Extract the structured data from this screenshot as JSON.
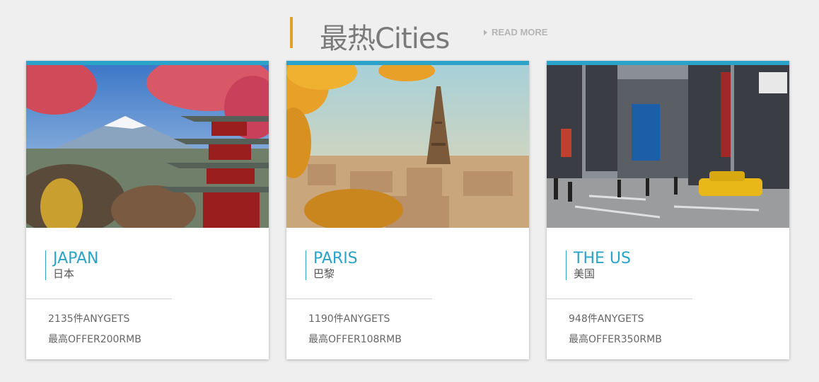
{
  "header": {
    "title": "最热Cities",
    "read_more": "READ MORE"
  },
  "colors": {
    "accent": "#2ba3c8",
    "header_bar": "#e0a02a",
    "background": "#efefef"
  },
  "cards": [
    {
      "name_en": "JAPAN",
      "name_cn": "日本",
      "count": "2135件ANYGETS",
      "offer": "最高OFFER200RMB",
      "image": "mount-fuji-pagoda-photo"
    },
    {
      "name_en": "PARIS",
      "name_cn": "巴黎",
      "count": "1190件ANYGETS",
      "offer": "最高OFFER108RMB",
      "image": "eiffel-tower-photo"
    },
    {
      "name_en": "THE US",
      "name_cn": "美国",
      "count": "948件ANYGETS",
      "offer": "最高OFFER350RMB",
      "image": "times-square-photo"
    }
  ]
}
